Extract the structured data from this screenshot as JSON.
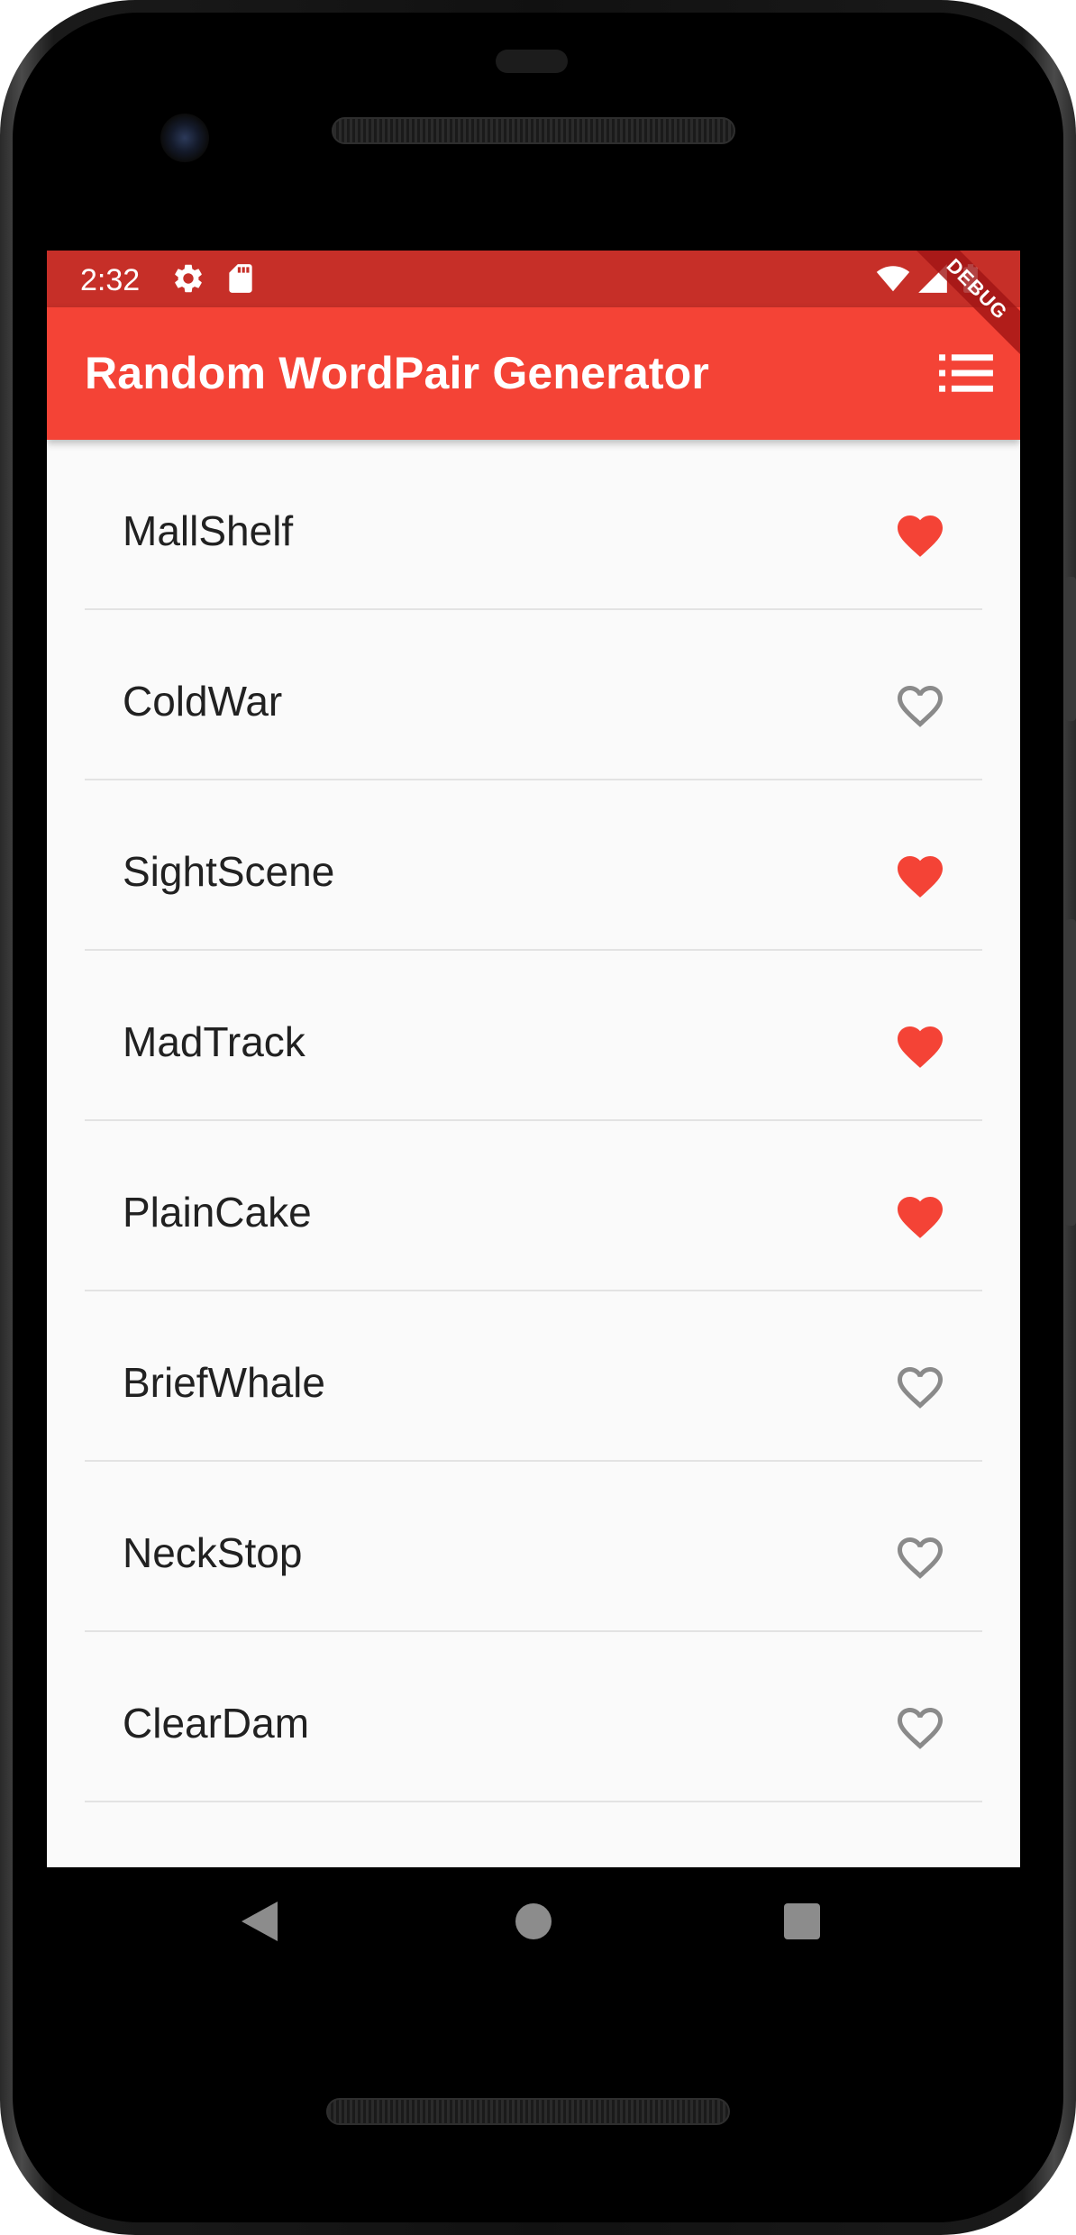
{
  "status_bar": {
    "time": "2:32",
    "icons": [
      "settings-icon",
      "sd-card-icon",
      "wifi-icon",
      "signal-icon",
      "battery-icon"
    ]
  },
  "app_bar": {
    "title": "Random WordPair Generator",
    "menu_icon": "list-icon",
    "debug_label": "DEBUG"
  },
  "colors": {
    "primary": "#f44336",
    "status_bar": "#c62f28",
    "heart_filled": "#f44336",
    "heart_outline": "#8a8a8a",
    "background": "#fafafa"
  },
  "list": [
    {
      "word": "MallShelf",
      "saved": true
    },
    {
      "word": "ColdWar",
      "saved": false
    },
    {
      "word": "SightScene",
      "saved": true
    },
    {
      "word": "MadTrack",
      "saved": true
    },
    {
      "word": "PlainCake",
      "saved": true
    },
    {
      "word": "BriefWhale",
      "saved": false
    },
    {
      "word": "NeckStop",
      "saved": false
    },
    {
      "word": "ClearDam",
      "saved": false
    }
  ],
  "nav_bar": {
    "back_icon": "back-icon",
    "home_icon": "home-icon",
    "recents_icon": "recents-icon"
  }
}
